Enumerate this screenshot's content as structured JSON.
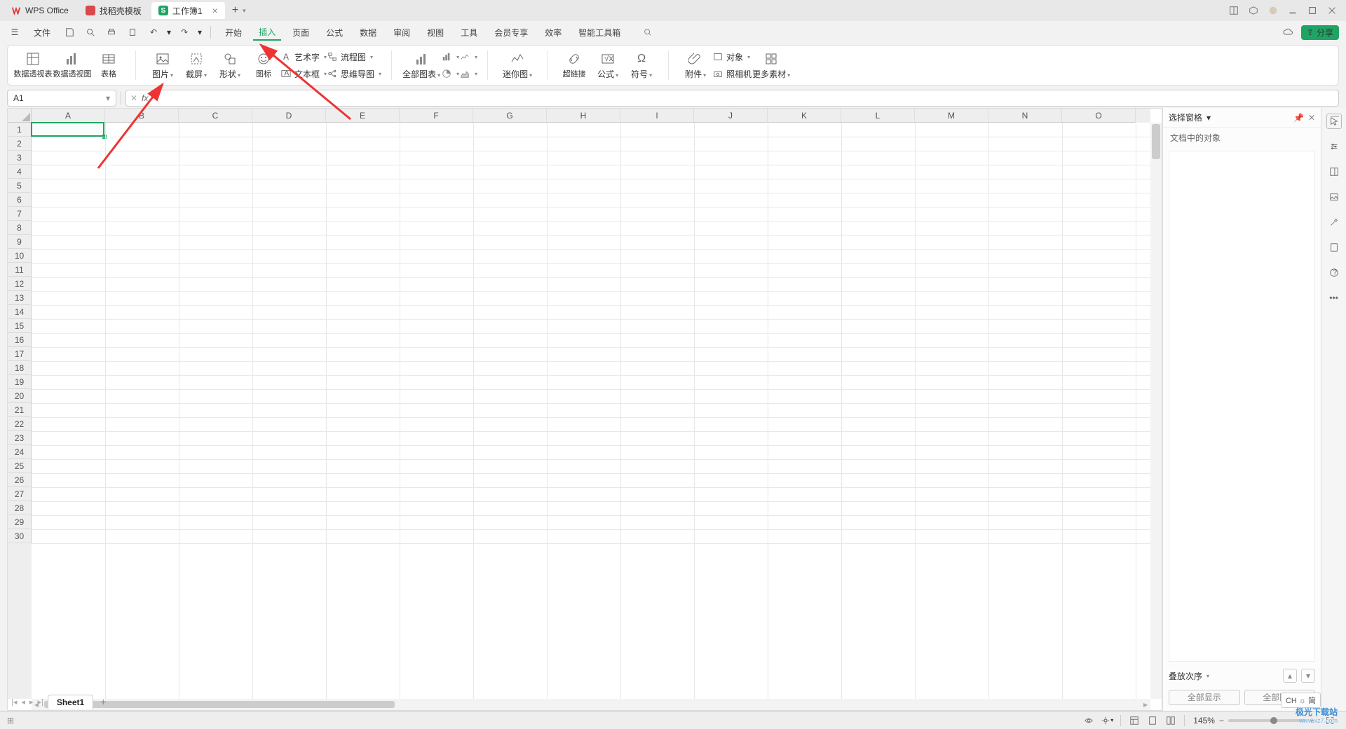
{
  "title": {
    "app": "WPS Office",
    "tpl": "找稻壳模板",
    "doc": "工作簿1"
  },
  "menu": {
    "file": "文件",
    "items": [
      "开始",
      "插入",
      "页面",
      "公式",
      "数据",
      "审阅",
      "视图",
      "工具",
      "会员专享",
      "效率",
      "智能工具箱"
    ],
    "share": "分享"
  },
  "ribbon": {
    "pivotTable": "数据透视表",
    "pivotChart": "数据透视图",
    "table": "表格",
    "picture": "图片",
    "screenshot": "截屏",
    "shapes": "形状",
    "icons": "图标",
    "wordart": "艺术字",
    "textbox": "文本框",
    "flowchart": "流程图",
    "mindmap": "思维导图",
    "allCharts": "全部图表",
    "sparkline": "迷你图",
    "hyperlink": "超链接",
    "equation": "公式",
    "symbol": "符号",
    "attachment": "附件",
    "object": "对象",
    "camera": "照相机",
    "moreAssets": "更多素材"
  },
  "namebox": "A1",
  "columns": [
    "A",
    "B",
    "C",
    "D",
    "E",
    "F",
    "G",
    "H",
    "I",
    "J",
    "K",
    "L",
    "M",
    "N",
    "O"
  ],
  "rowCount": 30,
  "panel": {
    "title": "选择窗格",
    "objects": "文档中的对象",
    "order": "叠放次序",
    "showAll": "全部显示",
    "hideAll": "全部隐藏"
  },
  "sheet": {
    "name": "Sheet1"
  },
  "status": {
    "zoom": "145%",
    "ime": "CH ☼ 简"
  },
  "watermark": {
    "l1": "极光下载站",
    "l2": "www.xz7.com"
  }
}
